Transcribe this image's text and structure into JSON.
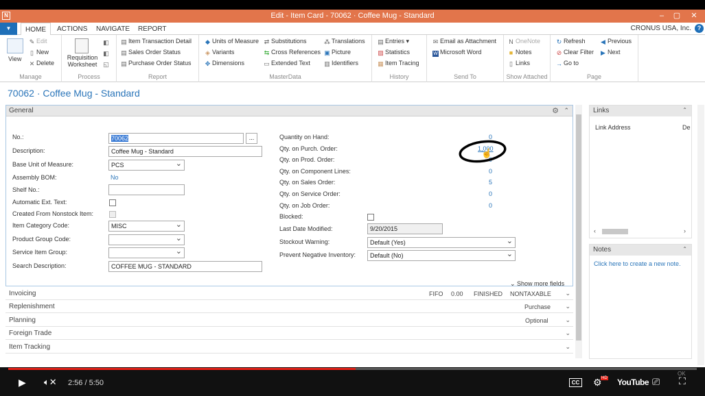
{
  "window": {
    "title": "Edit - Item Card - 70062 · Coffee Mug - Standard",
    "logo": "N",
    "controls": {
      "minimize": "–",
      "restore": "▢",
      "close": "✕"
    }
  },
  "tabs": [
    "HOME",
    "ACTIONS",
    "NAVIGATE",
    "REPORT"
  ],
  "company": "CRONUS USA, Inc.",
  "help_icon": "?",
  "ribbon": {
    "manage": {
      "label": "Manage",
      "view": "View",
      "edit": "Edit",
      "new": "New",
      "delete": "Delete"
    },
    "process": {
      "label": "Process",
      "requisition": "Requisition Worksheet"
    },
    "report": {
      "label": "Report",
      "items": [
        "Item Transaction Detail",
        "Sales Order Status",
        "Purchase Order Status"
      ]
    },
    "masterdata": {
      "label": "MasterData",
      "items": [
        "Units of Measure",
        "Variants",
        "Dimensions",
        "Substitutions",
        "Cross References",
        "Extended Text",
        "Translations",
        "Picture",
        "Identifiers"
      ]
    },
    "history": {
      "label": "History",
      "items": [
        "Entries",
        "Statistics",
        "Item Tracing"
      ]
    },
    "sendto": {
      "label": "Send To",
      "items": [
        "Email as Attachment",
        "Microsoft Word"
      ]
    },
    "attached": {
      "label": "Show Attached",
      "items": [
        "OneNote",
        "Notes",
        "Links"
      ]
    },
    "page": {
      "label": "Page",
      "items": [
        "Refresh",
        "Clear Filter",
        "Go to",
        "Previous",
        "Next"
      ]
    }
  },
  "page_title": "70062 · Coffee Mug - Standard",
  "general": {
    "title": "General",
    "left": [
      {
        "label": "No.:",
        "value": "70062"
      },
      {
        "label": "Description:",
        "value": "Coffee Mug - Standard"
      },
      {
        "label": "Base Unit of Measure:",
        "value": "PCS"
      },
      {
        "label": "Assembly BOM:",
        "value": "No"
      },
      {
        "label": "Shelf No.:",
        "value": ""
      },
      {
        "label": "Automatic Ext. Text:",
        "value": ""
      },
      {
        "label": "Created From Nonstock Item:",
        "value": ""
      },
      {
        "label": "Item Category Code:",
        "value": "MISC"
      },
      {
        "label": "Product Group Code:",
        "value": ""
      },
      {
        "label": "Service Item Group:",
        "value": ""
      },
      {
        "label": "Search Description:",
        "value": "COFFEE MUG - STANDARD"
      }
    ],
    "right": [
      {
        "label": "Quantity on Hand:",
        "value": "0"
      },
      {
        "label": "Qty. on Purch. Order:",
        "value": "1,000"
      },
      {
        "label": "Qty. on Prod. Order:",
        "value": "0"
      },
      {
        "label": "Qty. on Component Lines:",
        "value": "0"
      },
      {
        "label": "Qty. on Sales Order:",
        "value": "5"
      },
      {
        "label": "Qty. on Service Order:",
        "value": "0"
      },
      {
        "label": "Qty. on Job Order:",
        "value": "0"
      },
      {
        "label": "Blocked:",
        "value": ""
      },
      {
        "label": "Last Date Modified:",
        "value": "9/20/2015"
      },
      {
        "label": "Stockout Warning:",
        "value": "Default (Yes)"
      },
      {
        "label": "Prevent Negative Inventory:",
        "value": "Default (No)"
      }
    ],
    "show_more": "Show more fields",
    "lookup_btn": "..."
  },
  "fasttabs": [
    {
      "title": "Invoicing",
      "summary": [
        "FIFO",
        "0.00",
        "FINISHED",
        "NONTAXABLE"
      ]
    },
    {
      "title": "Replenishment",
      "summary": [
        "Purchase"
      ]
    },
    {
      "title": "Planning",
      "summary": [
        "Optional"
      ]
    },
    {
      "title": "Foreign Trade",
      "summary": []
    },
    {
      "title": "Item Tracking",
      "summary": []
    }
  ],
  "links_pane": {
    "title": "Links",
    "column1": "Link Address",
    "column2": "De"
  },
  "notes_pane": {
    "title": "Notes",
    "link": "Click here to create a new note."
  },
  "player": {
    "time": "2:56 / 5:50",
    "progress": 0.504,
    "cc": "CC",
    "hd": "HD",
    "brand": "YouTube",
    "ok": "OK"
  }
}
